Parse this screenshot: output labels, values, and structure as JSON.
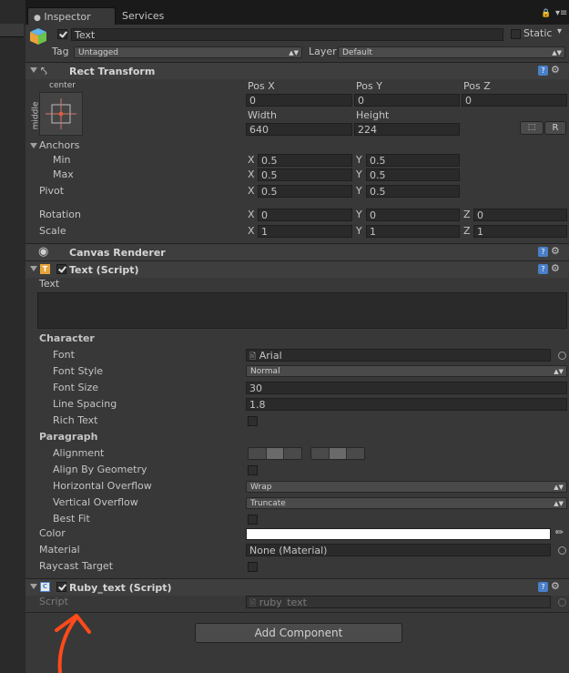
{
  "tabs": {
    "inspector": "Inspector",
    "services": "Services"
  },
  "object": {
    "name": "Text",
    "static_label": "Static",
    "tag_label": "Tag",
    "tag_value": "Untagged",
    "layer_label": "Layer",
    "layer_value": "Default"
  },
  "rect": {
    "title": "Rect Transform",
    "anchor_h": "center",
    "anchor_v": "middle",
    "posx_label": "Pos X",
    "posy_label": "Pos Y",
    "posz_label": "Pos Z",
    "posx": "0",
    "posy": "0",
    "posz": "0",
    "width_label": "Width",
    "height_label": "Height",
    "width": "640",
    "height": "224",
    "r_label": "R",
    "anchors_label": "Anchors",
    "min_label": "Min",
    "max_label": "Max",
    "pivot_label": "Pivot",
    "x": "X",
    "y": "Y",
    "z": "Z",
    "min_x": "0.5",
    "min_y": "0.5",
    "max_x": "0.5",
    "max_y": "0.5",
    "pivot_x": "0.5",
    "pivot_y": "0.5",
    "rotation_label": "Rotation",
    "scale_label": "Scale",
    "rot_x": "0",
    "rot_y": "0",
    "rot_z": "0",
    "scale_x": "1",
    "scale_y": "1",
    "scale_z": "1"
  },
  "canvas_renderer": {
    "title": "Canvas Renderer"
  },
  "text_script": {
    "title": "Text (Script)",
    "text_label": "Text",
    "text_value": "",
    "character_label": "Character",
    "font_label": "Font",
    "font_value": "Arial",
    "font_style_label": "Font Style",
    "font_style_value": "Normal",
    "font_size_label": "Font Size",
    "font_size_value": "30",
    "line_spacing_label": "Line Spacing",
    "line_spacing_value": "1.8",
    "rich_text_label": "Rich Text",
    "paragraph_label": "Paragraph",
    "alignment_label": "Alignment",
    "align_by_geometry_label": "Align By Geometry",
    "h_overflow_label": "Horizontal Overflow",
    "h_overflow_value": "Wrap",
    "v_overflow_label": "Vertical Overflow",
    "v_overflow_value": "Truncate",
    "best_fit_label": "Best Fit",
    "color_label": "Color",
    "color_value": "#ffffff",
    "material_label": "Material",
    "material_value": "None (Material)",
    "raycast_label": "Raycast Target"
  },
  "ruby": {
    "title": "Ruby_text (Script)",
    "script_label": "Script",
    "script_value": "ruby_text"
  },
  "add_component_label": "Add Component",
  "accent": {
    "arrow": "#ff4a1a",
    "help": "#4a7fc9"
  }
}
